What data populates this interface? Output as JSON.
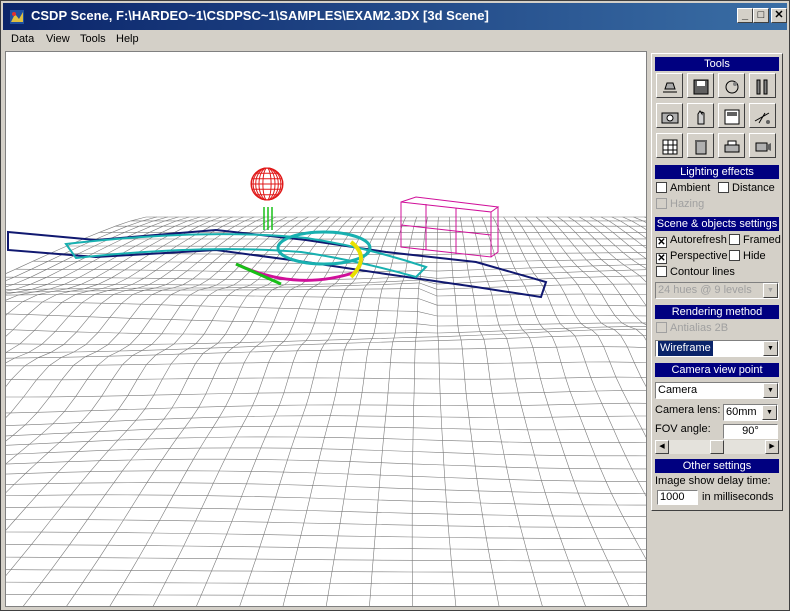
{
  "window": {
    "title": "CSDP Scene, F:\\HARDEO~1\\CSDPSC~1\\SAMPLES\\EXAM2.3DX [3d Scene]",
    "minimize": "_",
    "maximize": "□",
    "close": "✕"
  },
  "menu": {
    "items": [
      "Data",
      "View",
      "Tools",
      "Help"
    ]
  },
  "tools_panel": {
    "title": "Tools",
    "buttons": [
      "clean-icon",
      "save-icon",
      "scene-icon",
      "sliders-icon",
      "camera-icon",
      "hand-icon",
      "panel-icon",
      "plane-icon",
      "grid-icon",
      "trash-icon",
      "print-icon",
      "projector-icon"
    ],
    "lighting": {
      "header": "Lighting effects",
      "ambient": "Ambient",
      "distance": "Distance",
      "hazing": "Hazing"
    },
    "scene": {
      "header": "Scene & objects settings",
      "autorefresh": "Autorefresh",
      "framed": "Framed",
      "perspective": "Perspective",
      "hide": "Hide",
      "contour": "Contour lines",
      "hues": "24 hues @ 9 levels"
    },
    "rendering": {
      "header": "Rendering method",
      "antialias": "Antialias 2B",
      "method": "Wireframe"
    },
    "camera": {
      "header": "Camera view point",
      "viewpoint": "Camera",
      "lens_label": "Camera lens:",
      "lens": "60mm",
      "fov_label": "FOV angle:",
      "fov": "90°"
    },
    "other": {
      "header": "Other settings",
      "delay_label": "Image show delay time:",
      "delay": "1000",
      "unit": "in milliseconds"
    },
    "checked_mark": "✕",
    "arrow_down": "▼",
    "arrow_left": "◀",
    "arrow_right": "▶"
  },
  "colors": {
    "mesh": "#7a7a7a",
    "title_bar": "#0a246a",
    "section_header": "#000080",
    "sphere": "#e01818",
    "magenta": "#d0109a",
    "cyan": "#18b0b0",
    "navy": "#101870",
    "yellow": "#e8e000",
    "green": "#18c018"
  }
}
